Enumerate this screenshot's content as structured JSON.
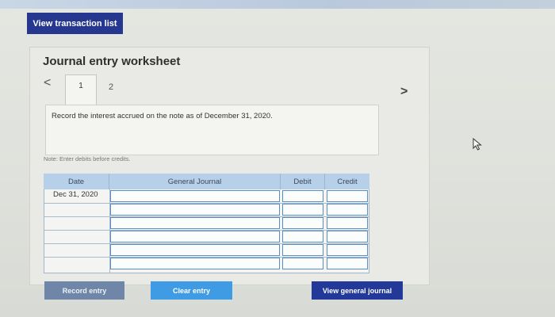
{
  "header": {
    "view_transaction_list_label": "View transaction list"
  },
  "worksheet": {
    "title": "Journal entry worksheet",
    "tabs": [
      {
        "label": "1"
      },
      {
        "label": "2"
      }
    ],
    "nav_prev": "<",
    "nav_next": ">",
    "instruction": "Record the interest accrued on the note as of December 31, 2020.",
    "note": "Note: Enter debits before credits."
  },
  "journal_table": {
    "columns": [
      "Date",
      "General Journal",
      "Debit",
      "Credit"
    ],
    "rows": [
      {
        "date": "Dec 31, 2020",
        "account": "",
        "debit": "",
        "credit": ""
      },
      {
        "date": "",
        "account": "",
        "debit": "",
        "credit": ""
      },
      {
        "date": "",
        "account": "",
        "debit": "",
        "credit": ""
      },
      {
        "date": "",
        "account": "",
        "debit": "",
        "credit": ""
      },
      {
        "date": "",
        "account": "",
        "debit": "",
        "credit": ""
      },
      {
        "date": "",
        "account": "",
        "debit": "",
        "credit": ""
      }
    ]
  },
  "footer": {
    "record_entry_label": "Record entry",
    "clear_entry_label": "Clear entry",
    "view_general_journal_label": "View general journal"
  },
  "colors": {
    "primary_button": "#25378f",
    "clear_button": "#3f9be3",
    "disabled_button": "#6f86a8",
    "table_header": "#b7d0ea"
  },
  "icons": {
    "cursor": "mouse-pointer-icon"
  }
}
